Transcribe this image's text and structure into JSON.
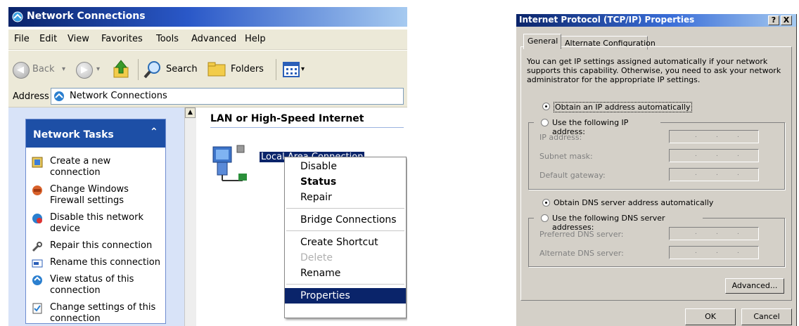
{
  "explorer": {
    "title": "Network Connections",
    "menu": [
      "File",
      "Edit",
      "View",
      "Favorites",
      "Tools",
      "Advanced",
      "Help"
    ],
    "toolbar": {
      "back": "Back",
      "search": "Search",
      "folders": "Folders"
    },
    "address_label": "Address",
    "address_value": "Network Connections",
    "tasks_title": "Network Tasks",
    "tasks": [
      {
        "icon": "create-connection-icon",
        "label": "Create a new connection"
      },
      {
        "icon": "firewall-icon",
        "label": "Change Windows Firewall settings"
      },
      {
        "icon": "disable-network-icon",
        "label": "Disable this network device"
      },
      {
        "icon": "repair-icon",
        "label": "Repair this connection"
      },
      {
        "icon": "rename-icon",
        "label": "Rename this connection"
      },
      {
        "icon": "status-icon",
        "label": "View status of this connection"
      },
      {
        "icon": "settings-icon",
        "label": "Change settings of this connection"
      }
    ],
    "group_header": "LAN or High-Speed Internet",
    "connection_label": "Local Area Connection"
  },
  "context_menu": {
    "items": [
      "Disable",
      "Status",
      "Repair",
      "Bridge Connections",
      "Create Shortcut",
      "Delete",
      "Rename",
      "Properties"
    ],
    "bold_item": "Status",
    "disabled_item": "Delete",
    "selected_item": "Properties"
  },
  "dialog": {
    "title": "Internet Protocol (TCP/IP) Properties",
    "help_btn": "?",
    "close_btn": "X",
    "tabs": [
      "General",
      "Alternate Configuration"
    ],
    "intro": "You can get IP settings assigned automatically if your network supports this capability. Otherwise, you need to ask your network administrator for the appropriate IP settings.",
    "ip_auto": "Obtain an IP address automatically",
    "ip_manual": "Use the following IP address:",
    "ip_fields": [
      "IP address:",
      "Subnet mask:",
      "Default gateway:"
    ],
    "dns_auto": "Obtain DNS server address automatically",
    "dns_manual": "Use the following DNS server addresses:",
    "dns_fields": [
      "Preferred DNS server:",
      "Alternate DNS server:"
    ],
    "advanced_btn": "Advanced...",
    "ok_btn": "OK",
    "cancel_btn": "Cancel"
  }
}
